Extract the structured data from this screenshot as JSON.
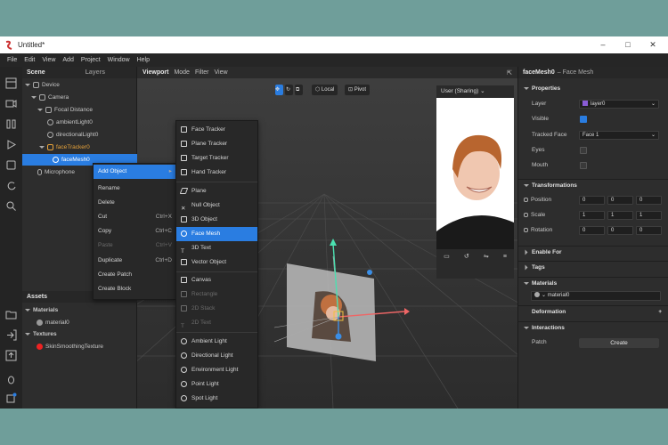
{
  "window": {
    "title": "Untitled*"
  },
  "menu": [
    "File",
    "Edit",
    "View",
    "Add",
    "Project",
    "Window",
    "Help"
  ],
  "scene": {
    "tab": "Scene",
    "tab2": "Layers",
    "items": [
      {
        "label": "Device"
      },
      {
        "label": "Camera"
      },
      {
        "label": "Focal Distance"
      },
      {
        "label": "ambientLight0"
      },
      {
        "label": "directionalLight0"
      },
      {
        "label": "faceTracker0"
      },
      {
        "label": "faceMesh0"
      },
      {
        "label": "Microphone"
      }
    ]
  },
  "assets": {
    "title": "Assets",
    "materials_label": "Materials",
    "material": "material0",
    "textures_label": "Textures",
    "texture": "SkinSmoothingTexture"
  },
  "viewport": {
    "tabs": [
      "Viewport",
      "Mode",
      "Filter",
      "View"
    ],
    "local": "Local",
    "pivot": "Pivot",
    "preview_device": "User (Sharing)"
  },
  "context_menu": [
    {
      "label": "Add Object",
      "shortcut": ""
    },
    {
      "label": "Rename",
      "shortcut": ""
    },
    {
      "label": "Delete",
      "shortcut": ""
    },
    {
      "label": "Cut",
      "shortcut": "Ctrl+X"
    },
    {
      "label": "Copy",
      "shortcut": "Ctrl+C"
    },
    {
      "label": "Paste",
      "shortcut": "Ctrl+V"
    },
    {
      "label": "Duplicate",
      "shortcut": "Ctrl+D"
    },
    {
      "label": "Create Patch",
      "shortcut": ""
    },
    {
      "label": "Create Block",
      "shortcut": ""
    }
  ],
  "submenu": [
    {
      "label": "Face Tracker"
    },
    {
      "label": "Plane Tracker"
    },
    {
      "label": "Target Tracker"
    },
    {
      "label": "Hand Tracker"
    },
    {
      "label": "Plane"
    },
    {
      "label": "Null Object"
    },
    {
      "label": "3D Object"
    },
    {
      "label": "Face Mesh"
    },
    {
      "label": "3D Text"
    },
    {
      "label": "Vector Object"
    },
    {
      "label": "Canvas"
    },
    {
      "label": "Rectangle"
    },
    {
      "label": "2D Stack"
    },
    {
      "label": "2D Text"
    },
    {
      "label": "Ambient Light"
    },
    {
      "label": "Directional Light"
    },
    {
      "label": "Environment Light"
    },
    {
      "label": "Point Light"
    },
    {
      "label": "Spot Light"
    }
  ],
  "inspector": {
    "name": "faceMesh0",
    "type": "– Face Mesh",
    "properties": "Properties",
    "layer_label": "Layer",
    "layer_value": "layer0",
    "visible_label": "Visible",
    "tracked_label": "Tracked Face",
    "tracked_value": "Face 1",
    "eyes_label": "Eyes",
    "mouth_label": "Mouth",
    "transformations": "Transformations",
    "position_label": "Position",
    "position": [
      "0",
      "0",
      "0"
    ],
    "scale_label": "Scale",
    "scale": [
      "1",
      "1",
      "1"
    ],
    "rotation_label": "Rotation",
    "rotation": [
      "0",
      "0",
      "0"
    ],
    "enable_for": "Enable For",
    "tags": "Tags",
    "materials": "Materials",
    "material_value": "material0",
    "deformation": "Deformation",
    "interactions": "Interactions",
    "patch_label": "Patch",
    "create_button": "Create"
  },
  "colors": {
    "accent": "#2a7de1",
    "background": "#6f9e9a",
    "panel": "#2d2d2d"
  }
}
